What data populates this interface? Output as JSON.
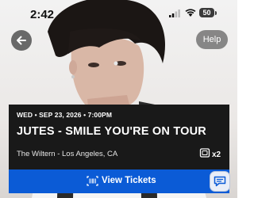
{
  "status_bar": {
    "time": "2:42",
    "battery": "50",
    "icons": [
      "signal-icon",
      "wifi-icon",
      "battery-icon"
    ]
  },
  "nav": {
    "back_icon": "arrow-left-icon",
    "help_label": "Help"
  },
  "event": {
    "date_time": "WED • SEP 23, 2026 • 7:00PM",
    "title": "JUTES - SMILE YOU'RE ON TOUR",
    "venue": "The Wiltern - Los Angeles, CA",
    "ticket_count": "x2",
    "ticket_icon": "ticket-icon"
  },
  "actions": {
    "view_tickets_label": "View Tickets",
    "view_tickets_icon": "barcode-icon",
    "chat_icon": "chat-icon"
  },
  "colors": {
    "accent": "#0b5bd6",
    "card_bg": "#191919"
  }
}
